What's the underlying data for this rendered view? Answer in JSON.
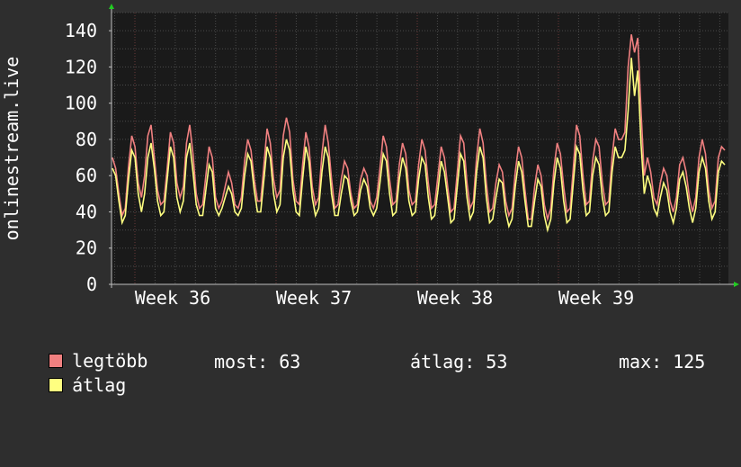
{
  "chart_data": {
    "type": "line",
    "ylabel": "onlinestream.live",
    "ylim": [
      0,
      150
    ],
    "yticks": [
      0,
      20,
      40,
      60,
      80,
      100,
      120,
      140
    ],
    "xticks": [
      "Week 36",
      "Week 37",
      "Week 38",
      "Week 39"
    ],
    "grid": true,
    "colors": {
      "background": "#2e2e2e",
      "plot_background": "#1a1a1a",
      "grid": "#4a4a4a",
      "axis": "#c0c0c0",
      "max_series": "#f08080",
      "avg_series": "#ffff80"
    },
    "series": [
      {
        "name": "legtöbb",
        "color": "#f08080",
        "values": [
          70,
          64,
          50,
          38,
          42,
          65,
          82,
          76,
          56,
          48,
          60,
          82,
          88,
          70,
          52,
          44,
          46,
          64,
          84,
          78,
          56,
          48,
          54,
          78,
          88,
          72,
          50,
          42,
          44,
          60,
          76,
          70,
          48,
          42,
          46,
          54,
          62,
          56,
          44,
          42,
          48,
          68,
          80,
          74,
          58,
          46,
          46,
          66,
          86,
          78,
          58,
          48,
          52,
          82,
          92,
          84,
          58,
          46,
          44,
          66,
          84,
          76,
          54,
          44,
          48,
          72,
          88,
          78,
          58,
          42,
          44,
          58,
          68,
          64,
          50,
          42,
          44,
          58,
          64,
          60,
          46,
          42,
          48,
          64,
          82,
          76,
          58,
          44,
          46,
          66,
          78,
          72,
          52,
          44,
          46,
          66,
          80,
          74,
          56,
          42,
          44,
          60,
          76,
          70,
          54,
          40,
          42,
          62,
          82,
          78,
          56,
          42,
          46,
          70,
          86,
          78,
          56,
          40,
          42,
          56,
          66,
          62,
          46,
          38,
          42,
          62,
          76,
          70,
          52,
          36,
          36,
          54,
          66,
          60,
          44,
          36,
          42,
          64,
          78,
          72,
          54,
          40,
          42,
          64,
          88,
          82,
          60,
          44,
          46,
          68,
          80,
          76,
          56,
          44,
          46,
          70,
          86,
          80,
          80,
          84,
          120,
          138,
          128,
          136,
          96,
          60,
          70,
          62,
          48,
          44,
          56,
          64,
          60,
          46,
          40,
          48,
          66,
          70,
          62,
          48,
          40,
          48,
          70,
          80,
          72,
          52,
          42,
          46,
          70,
          76,
          74
        ]
      },
      {
        "name": "átlag",
        "color": "#ffff80",
        "values": [
          64,
          60,
          46,
          34,
          38,
          58,
          74,
          70,
          50,
          40,
          50,
          70,
          78,
          64,
          46,
          38,
          40,
          58,
          76,
          70,
          48,
          40,
          46,
          70,
          78,
          62,
          44,
          38,
          38,
          52,
          66,
          62,
          42,
          38,
          42,
          48,
          54,
          50,
          40,
          38,
          42,
          60,
          72,
          68,
          52,
          40,
          40,
          58,
          76,
          70,
          50,
          40,
          44,
          70,
          80,
          74,
          52,
          40,
          38,
          58,
          76,
          68,
          48,
          38,
          42,
          62,
          76,
          70,
          50,
          38,
          38,
          50,
          60,
          58,
          46,
          38,
          40,
          52,
          58,
          54,
          42,
          38,
          42,
          56,
          72,
          68,
          50,
          38,
          40,
          58,
          70,
          64,
          46,
          38,
          40,
          58,
          70,
          66,
          48,
          36,
          38,
          52,
          68,
          62,
          48,
          34,
          36,
          54,
          72,
          68,
          48,
          36,
          40,
          62,
          76,
          70,
          48,
          34,
          36,
          48,
          58,
          56,
          40,
          32,
          36,
          54,
          68,
          62,
          46,
          32,
          32,
          46,
          58,
          54,
          38,
          30,
          36,
          56,
          70,
          64,
          46,
          34,
          36,
          56,
          76,
          72,
          52,
          38,
          40,
          60,
          70,
          66,
          48,
          38,
          40,
          62,
          76,
          70,
          70,
          74,
          96,
          125,
          104,
          118,
          78,
          50,
          60,
          54,
          42,
          38,
          48,
          56,
          52,
          40,
          34,
          42,
          58,
          62,
          54,
          42,
          34,
          42,
          62,
          70,
          64,
          46,
          36,
          40,
          62,
          68,
          66
        ]
      }
    ],
    "stats": {
      "most": 63,
      "atlag": 53,
      "max": 125
    }
  },
  "legend": {
    "max_label": "legtöbb",
    "avg_label": "átlag",
    "most_text": "most: 63",
    "atlag_text": "átlag: 53",
    "max_text": "max: 125"
  }
}
